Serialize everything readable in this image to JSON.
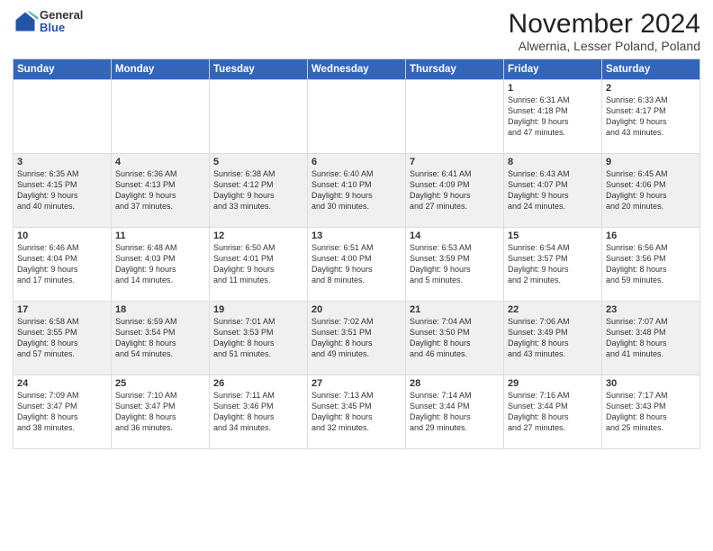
{
  "header": {
    "logo_general": "General",
    "logo_blue": "Blue",
    "month_title": "November 2024",
    "subtitle": "Alwernia, Lesser Poland, Poland"
  },
  "days_of_week": [
    "Sunday",
    "Monday",
    "Tuesday",
    "Wednesday",
    "Thursday",
    "Friday",
    "Saturday"
  ],
  "weeks": [
    [
      {
        "day": "",
        "info": ""
      },
      {
        "day": "",
        "info": ""
      },
      {
        "day": "",
        "info": ""
      },
      {
        "day": "",
        "info": ""
      },
      {
        "day": "",
        "info": ""
      },
      {
        "day": "1",
        "info": "Sunrise: 6:31 AM\nSunset: 4:18 PM\nDaylight: 9 hours\nand 47 minutes."
      },
      {
        "day": "2",
        "info": "Sunrise: 6:33 AM\nSunset: 4:17 PM\nDaylight: 9 hours\nand 43 minutes."
      }
    ],
    [
      {
        "day": "3",
        "info": "Sunrise: 6:35 AM\nSunset: 4:15 PM\nDaylight: 9 hours\nand 40 minutes."
      },
      {
        "day": "4",
        "info": "Sunrise: 6:36 AM\nSunset: 4:13 PM\nDaylight: 9 hours\nand 37 minutes."
      },
      {
        "day": "5",
        "info": "Sunrise: 6:38 AM\nSunset: 4:12 PM\nDaylight: 9 hours\nand 33 minutes."
      },
      {
        "day": "6",
        "info": "Sunrise: 6:40 AM\nSunset: 4:10 PM\nDaylight: 9 hours\nand 30 minutes."
      },
      {
        "day": "7",
        "info": "Sunrise: 6:41 AM\nSunset: 4:09 PM\nDaylight: 9 hours\nand 27 minutes."
      },
      {
        "day": "8",
        "info": "Sunrise: 6:43 AM\nSunset: 4:07 PM\nDaylight: 9 hours\nand 24 minutes."
      },
      {
        "day": "9",
        "info": "Sunrise: 6:45 AM\nSunset: 4:06 PM\nDaylight: 9 hours\nand 20 minutes."
      }
    ],
    [
      {
        "day": "10",
        "info": "Sunrise: 6:46 AM\nSunset: 4:04 PM\nDaylight: 9 hours\nand 17 minutes."
      },
      {
        "day": "11",
        "info": "Sunrise: 6:48 AM\nSunset: 4:03 PM\nDaylight: 9 hours\nand 14 minutes."
      },
      {
        "day": "12",
        "info": "Sunrise: 6:50 AM\nSunset: 4:01 PM\nDaylight: 9 hours\nand 11 minutes."
      },
      {
        "day": "13",
        "info": "Sunrise: 6:51 AM\nSunset: 4:00 PM\nDaylight: 9 hours\nand 8 minutes."
      },
      {
        "day": "14",
        "info": "Sunrise: 6:53 AM\nSunset: 3:59 PM\nDaylight: 9 hours\nand 5 minutes."
      },
      {
        "day": "15",
        "info": "Sunrise: 6:54 AM\nSunset: 3:57 PM\nDaylight: 9 hours\nand 2 minutes."
      },
      {
        "day": "16",
        "info": "Sunrise: 6:56 AM\nSunset: 3:56 PM\nDaylight: 8 hours\nand 59 minutes."
      }
    ],
    [
      {
        "day": "17",
        "info": "Sunrise: 6:58 AM\nSunset: 3:55 PM\nDaylight: 8 hours\nand 57 minutes."
      },
      {
        "day": "18",
        "info": "Sunrise: 6:59 AM\nSunset: 3:54 PM\nDaylight: 8 hours\nand 54 minutes."
      },
      {
        "day": "19",
        "info": "Sunrise: 7:01 AM\nSunset: 3:53 PM\nDaylight: 8 hours\nand 51 minutes."
      },
      {
        "day": "20",
        "info": "Sunrise: 7:02 AM\nSunset: 3:51 PM\nDaylight: 8 hours\nand 49 minutes."
      },
      {
        "day": "21",
        "info": "Sunrise: 7:04 AM\nSunset: 3:50 PM\nDaylight: 8 hours\nand 46 minutes."
      },
      {
        "day": "22",
        "info": "Sunrise: 7:06 AM\nSunset: 3:49 PM\nDaylight: 8 hours\nand 43 minutes."
      },
      {
        "day": "23",
        "info": "Sunrise: 7:07 AM\nSunset: 3:48 PM\nDaylight: 8 hours\nand 41 minutes."
      }
    ],
    [
      {
        "day": "24",
        "info": "Sunrise: 7:09 AM\nSunset: 3:47 PM\nDaylight: 8 hours\nand 38 minutes."
      },
      {
        "day": "25",
        "info": "Sunrise: 7:10 AM\nSunset: 3:47 PM\nDaylight: 8 hours\nand 36 minutes."
      },
      {
        "day": "26",
        "info": "Sunrise: 7:11 AM\nSunset: 3:46 PM\nDaylight: 8 hours\nand 34 minutes."
      },
      {
        "day": "27",
        "info": "Sunrise: 7:13 AM\nSunset: 3:45 PM\nDaylight: 8 hours\nand 32 minutes."
      },
      {
        "day": "28",
        "info": "Sunrise: 7:14 AM\nSunset: 3:44 PM\nDaylight: 8 hours\nand 29 minutes."
      },
      {
        "day": "29",
        "info": "Sunrise: 7:16 AM\nSunset: 3:44 PM\nDaylight: 8 hours\nand 27 minutes."
      },
      {
        "day": "30",
        "info": "Sunrise: 7:17 AM\nSunset: 3:43 PM\nDaylight: 8 hours\nand 25 minutes."
      }
    ]
  ]
}
